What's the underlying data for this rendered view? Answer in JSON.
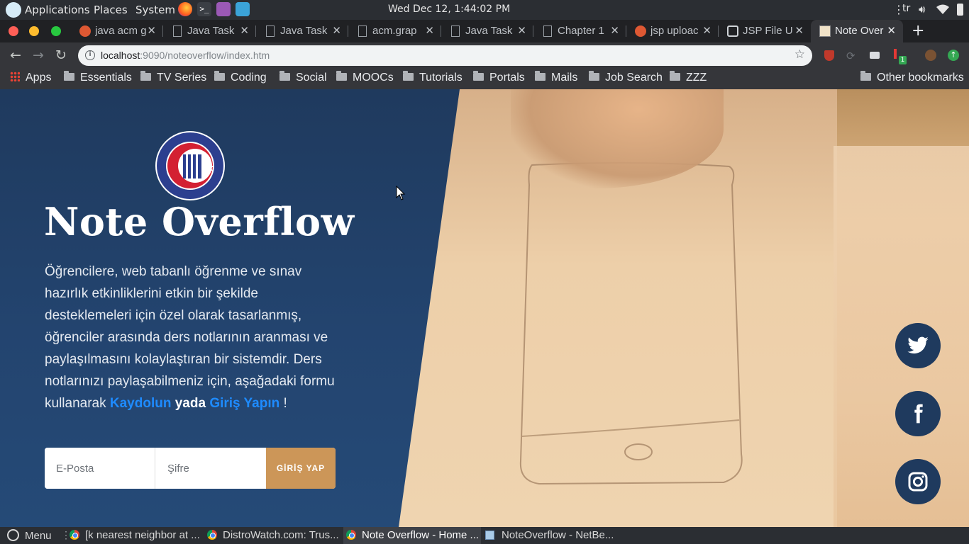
{
  "top_panel": {
    "menus": [
      "Applications",
      "Places",
      "System"
    ],
    "clock": "Wed Dec 12,  1:44:02 PM",
    "keyboard_layout": "tr"
  },
  "browser": {
    "tabs": [
      {
        "title": "java acm g",
        "icon": "duckduckgo-icon"
      },
      {
        "title": "Java Task",
        "icon": "page-icon"
      },
      {
        "title": "Java Task",
        "icon": "page-icon"
      },
      {
        "title": "acm.grap",
        "icon": "page-icon"
      },
      {
        "title": "Java Task",
        "icon": "page-icon"
      },
      {
        "title": "Chapter 1",
        "icon": "page-icon"
      },
      {
        "title": "jsp uploac",
        "icon": "duckduckgo-icon"
      },
      {
        "title": "JSP File U",
        "icon": "site-icon"
      },
      {
        "title": "Note Over",
        "icon": "noteoverflow-icon",
        "active": true
      }
    ],
    "url_host": "localhost",
    "url_rest": ":9090/noteoverflow/index.htm",
    "bookmarks": {
      "apps": "Apps",
      "folders": [
        "Essentials",
        "TV Series",
        "Coding",
        "Social",
        "MOOCs",
        "Tutorials",
        "Portals",
        "Mails",
        "Job Search",
        "ZZZ"
      ],
      "other": "Other bookmarks"
    },
    "extension_badge": "1"
  },
  "page": {
    "title": "Note Overflow",
    "description": "Öğrencilere, web tabanlı öğrenme ve sınav hazırlık etkinliklerini etkin bir şekilde desteklemeleri için özel olarak tasarlanmış, öğrenciler arasında ders notlarının aranması ve paylaşılmasını kolaylaştıran bir sistemdir. Ders notlarınızı paylaşabilmeniz için, aşağadaki formu kullanarak ",
    "register_link": "Kaydolun",
    "or_text": "yada",
    "login_link": "Giriş Yapın",
    "end_punct": " !",
    "logo_text": "ÇANAKKALE ONSEKİZ MART ÜNİVERSİTESİ",
    "logo_year": "1992",
    "form": {
      "email_placeholder": "E-Posta",
      "password_placeholder": "Şifre",
      "submit_label": "GİRİŞ YAP"
    },
    "social": [
      "twitter-icon",
      "facebook-icon",
      "instagram-icon"
    ],
    "colors": {
      "panel": "#1f3a5e",
      "accent": "#cc9658",
      "link": "#1e8bff"
    }
  },
  "taskbar": {
    "menu_label": "Menu",
    "windows": [
      {
        "title": "[k nearest neighbor at ...",
        "icon": "chrome-icon"
      },
      {
        "title": "DistroWatch.com: Trus...",
        "icon": "chrome-icon"
      },
      {
        "title": "Note Overflow - Home ...",
        "icon": "chrome-icon",
        "active": true
      },
      {
        "title": "NoteOverflow - NetBe...",
        "icon": "netbeans-icon"
      }
    ]
  }
}
